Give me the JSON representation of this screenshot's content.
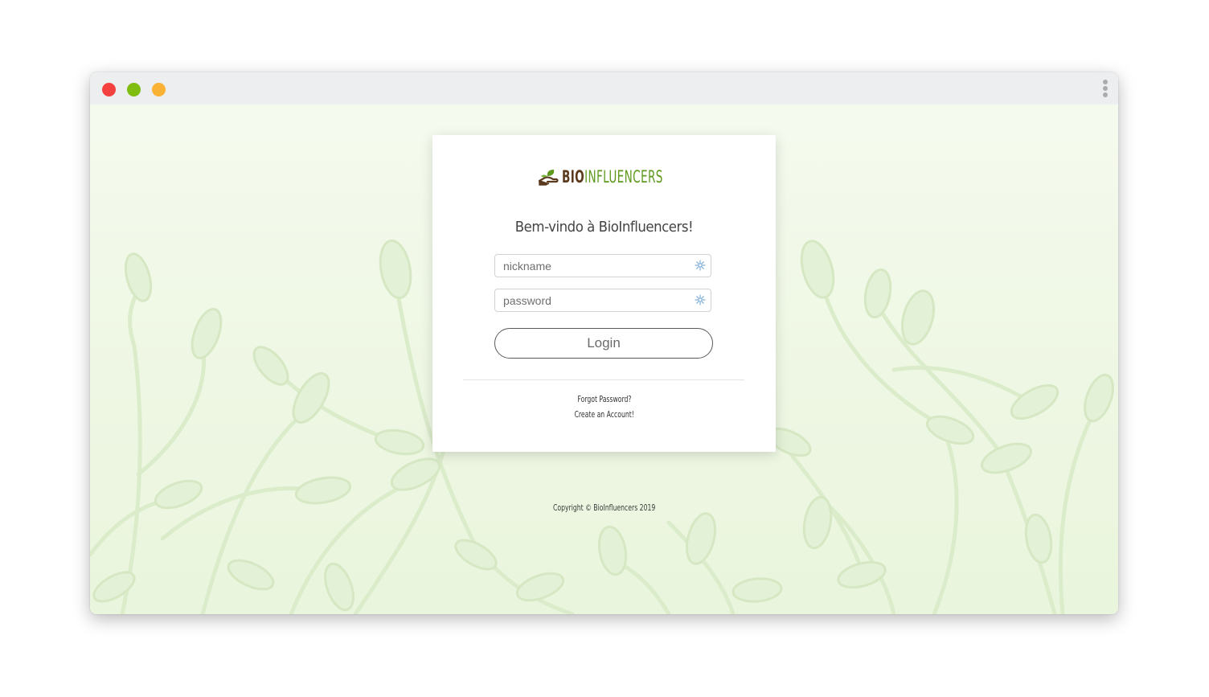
{
  "window": {
    "controls": [
      "close",
      "minimize",
      "maximize"
    ],
    "menu_icon": "kebab-menu-icon"
  },
  "brand": {
    "name_part1": "BIO",
    "name_part2": "INFLUENCERS",
    "logo_icon": "hand-leaf-icon",
    "color_primary": "#5b3a1e",
    "color_accent": "#5f9a1f"
  },
  "login": {
    "welcome": "Bem-vindo à BioInfluencers!",
    "nickname_placeholder": "nickname",
    "password_placeholder": "password",
    "field_icon": "sparkle-icon",
    "login_label": "Login",
    "forgot_password": "Forgot Password?",
    "create_account": "Create an Account!"
  },
  "footer": {
    "copyright": "Copyright © BioInfluencers 2019"
  },
  "colors": {
    "background": "#f1f8e9",
    "titlebar": "#eceeef",
    "close": "#f4413f",
    "minimize": "#7fbd10",
    "maximize": "#f9b233"
  }
}
